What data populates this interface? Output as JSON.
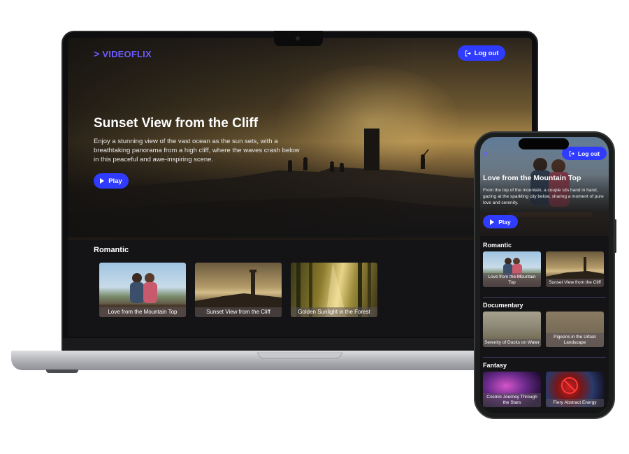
{
  "brand": {
    "logo_text": "VIDEOFLIX",
    "accent": "#2f3bff",
    "logo_color": "#6c5cff"
  },
  "laptop": {
    "logout_label": "Log out",
    "hero": {
      "title": "Sunset View from the Cliff",
      "description": "Enjoy a stunning view of the vast ocean as the sun sets, with a breathtaking panorama from a high cliff, where the waves crash below in this peaceful and awe-inspiring scene.",
      "play_label": "Play"
    },
    "sections": [
      {
        "title": "Romantic",
        "videos": [
          {
            "title": "Love from the Mountain Top"
          },
          {
            "title": "Sunset View from the Cliff"
          },
          {
            "title": "Golden Sunlight in the Forest"
          }
        ]
      }
    ]
  },
  "phone": {
    "logout_label": "Log out",
    "hero": {
      "title": "Love from the Mountain Top",
      "description": "From the top of the mountain, a couple sits hand in hand, gazing at the sparkling city below, sharing a moment of pure love and serenity.",
      "play_label": "Play"
    },
    "sections": [
      {
        "title": "Romantic",
        "videos": [
          {
            "title": "Love from the Mountain Top"
          },
          {
            "title": "Sunset View from the Cliff"
          }
        ]
      },
      {
        "title": "Documentary",
        "videos": [
          {
            "title": "Serenity of Ducks on Water"
          },
          {
            "title": "Pigeons in the Urban Landscape"
          }
        ]
      },
      {
        "title": "Fantasy",
        "videos": [
          {
            "title": "Cosmic Journey Through the Stars"
          },
          {
            "title": "Fiery Abstract Energy"
          }
        ]
      }
    ]
  }
}
